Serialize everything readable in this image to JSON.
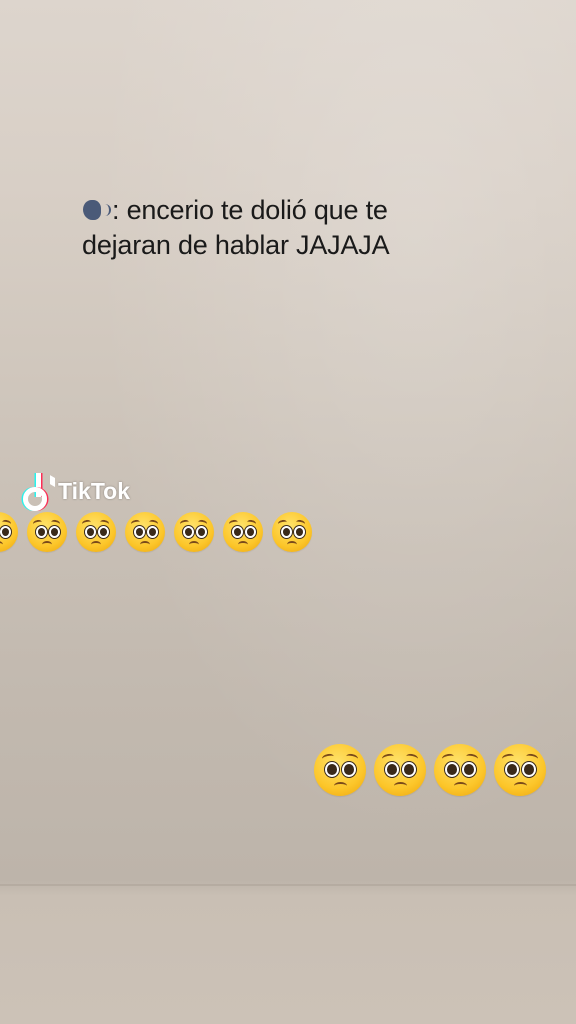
{
  "caption": {
    "icon": "speaking-head-icon",
    "line1": ": encerio te dolió que te",
    "line2": "dejaran de hablar JAJAJA"
  },
  "watermark": {
    "brand": "TikTok",
    "icon": "tiktok-note-icon"
  },
  "emoji_rows": {
    "top": {
      "emoji": "pleading-face",
      "count": 7
    },
    "bottom": {
      "emoji": "pleading-face",
      "count": 4
    }
  },
  "colors": {
    "caption_text": "#1a1a1a",
    "emoji_yellow": "#fcc62a",
    "tiktok_cyan": "#25f4ee",
    "tiktok_red": "#fe2c55"
  }
}
